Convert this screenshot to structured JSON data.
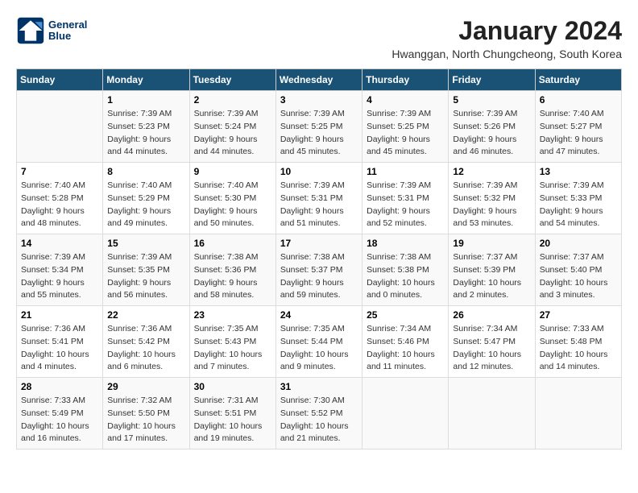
{
  "logo": {
    "line1": "General",
    "line2": "Blue"
  },
  "title": "January 2024",
  "subtitle": "Hwanggan, North Chungcheong, South Korea",
  "days_of_week": [
    "Sunday",
    "Monday",
    "Tuesday",
    "Wednesday",
    "Thursday",
    "Friday",
    "Saturday"
  ],
  "weeks": [
    [
      {
        "day": "",
        "info": ""
      },
      {
        "day": "1",
        "info": "Sunrise: 7:39 AM\nSunset: 5:23 PM\nDaylight: 9 hours\nand 44 minutes."
      },
      {
        "day": "2",
        "info": "Sunrise: 7:39 AM\nSunset: 5:24 PM\nDaylight: 9 hours\nand 44 minutes."
      },
      {
        "day": "3",
        "info": "Sunrise: 7:39 AM\nSunset: 5:25 PM\nDaylight: 9 hours\nand 45 minutes."
      },
      {
        "day": "4",
        "info": "Sunrise: 7:39 AM\nSunset: 5:25 PM\nDaylight: 9 hours\nand 45 minutes."
      },
      {
        "day": "5",
        "info": "Sunrise: 7:39 AM\nSunset: 5:26 PM\nDaylight: 9 hours\nand 46 minutes."
      },
      {
        "day": "6",
        "info": "Sunrise: 7:40 AM\nSunset: 5:27 PM\nDaylight: 9 hours\nand 47 minutes."
      }
    ],
    [
      {
        "day": "7",
        "info": "Sunrise: 7:40 AM\nSunset: 5:28 PM\nDaylight: 9 hours\nand 48 minutes."
      },
      {
        "day": "8",
        "info": "Sunrise: 7:40 AM\nSunset: 5:29 PM\nDaylight: 9 hours\nand 49 minutes."
      },
      {
        "day": "9",
        "info": "Sunrise: 7:40 AM\nSunset: 5:30 PM\nDaylight: 9 hours\nand 50 minutes."
      },
      {
        "day": "10",
        "info": "Sunrise: 7:39 AM\nSunset: 5:31 PM\nDaylight: 9 hours\nand 51 minutes."
      },
      {
        "day": "11",
        "info": "Sunrise: 7:39 AM\nSunset: 5:31 PM\nDaylight: 9 hours\nand 52 minutes."
      },
      {
        "day": "12",
        "info": "Sunrise: 7:39 AM\nSunset: 5:32 PM\nDaylight: 9 hours\nand 53 minutes."
      },
      {
        "day": "13",
        "info": "Sunrise: 7:39 AM\nSunset: 5:33 PM\nDaylight: 9 hours\nand 54 minutes."
      }
    ],
    [
      {
        "day": "14",
        "info": "Sunrise: 7:39 AM\nSunset: 5:34 PM\nDaylight: 9 hours\nand 55 minutes."
      },
      {
        "day": "15",
        "info": "Sunrise: 7:39 AM\nSunset: 5:35 PM\nDaylight: 9 hours\nand 56 minutes."
      },
      {
        "day": "16",
        "info": "Sunrise: 7:38 AM\nSunset: 5:36 PM\nDaylight: 9 hours\nand 58 minutes."
      },
      {
        "day": "17",
        "info": "Sunrise: 7:38 AM\nSunset: 5:37 PM\nDaylight: 9 hours\nand 59 minutes."
      },
      {
        "day": "18",
        "info": "Sunrise: 7:38 AM\nSunset: 5:38 PM\nDaylight: 10 hours\nand 0 minutes."
      },
      {
        "day": "19",
        "info": "Sunrise: 7:37 AM\nSunset: 5:39 PM\nDaylight: 10 hours\nand 2 minutes."
      },
      {
        "day": "20",
        "info": "Sunrise: 7:37 AM\nSunset: 5:40 PM\nDaylight: 10 hours\nand 3 minutes."
      }
    ],
    [
      {
        "day": "21",
        "info": "Sunrise: 7:36 AM\nSunset: 5:41 PM\nDaylight: 10 hours\nand 4 minutes."
      },
      {
        "day": "22",
        "info": "Sunrise: 7:36 AM\nSunset: 5:42 PM\nDaylight: 10 hours\nand 6 minutes."
      },
      {
        "day": "23",
        "info": "Sunrise: 7:35 AM\nSunset: 5:43 PM\nDaylight: 10 hours\nand 7 minutes."
      },
      {
        "day": "24",
        "info": "Sunrise: 7:35 AM\nSunset: 5:44 PM\nDaylight: 10 hours\nand 9 minutes."
      },
      {
        "day": "25",
        "info": "Sunrise: 7:34 AM\nSunset: 5:46 PM\nDaylight: 10 hours\nand 11 minutes."
      },
      {
        "day": "26",
        "info": "Sunrise: 7:34 AM\nSunset: 5:47 PM\nDaylight: 10 hours\nand 12 minutes."
      },
      {
        "day": "27",
        "info": "Sunrise: 7:33 AM\nSunset: 5:48 PM\nDaylight: 10 hours\nand 14 minutes."
      }
    ],
    [
      {
        "day": "28",
        "info": "Sunrise: 7:33 AM\nSunset: 5:49 PM\nDaylight: 10 hours\nand 16 minutes."
      },
      {
        "day": "29",
        "info": "Sunrise: 7:32 AM\nSunset: 5:50 PM\nDaylight: 10 hours\nand 17 minutes."
      },
      {
        "day": "30",
        "info": "Sunrise: 7:31 AM\nSunset: 5:51 PM\nDaylight: 10 hours\nand 19 minutes."
      },
      {
        "day": "31",
        "info": "Sunrise: 7:30 AM\nSunset: 5:52 PM\nDaylight: 10 hours\nand 21 minutes."
      },
      {
        "day": "",
        "info": ""
      },
      {
        "day": "",
        "info": ""
      },
      {
        "day": "",
        "info": ""
      }
    ]
  ]
}
